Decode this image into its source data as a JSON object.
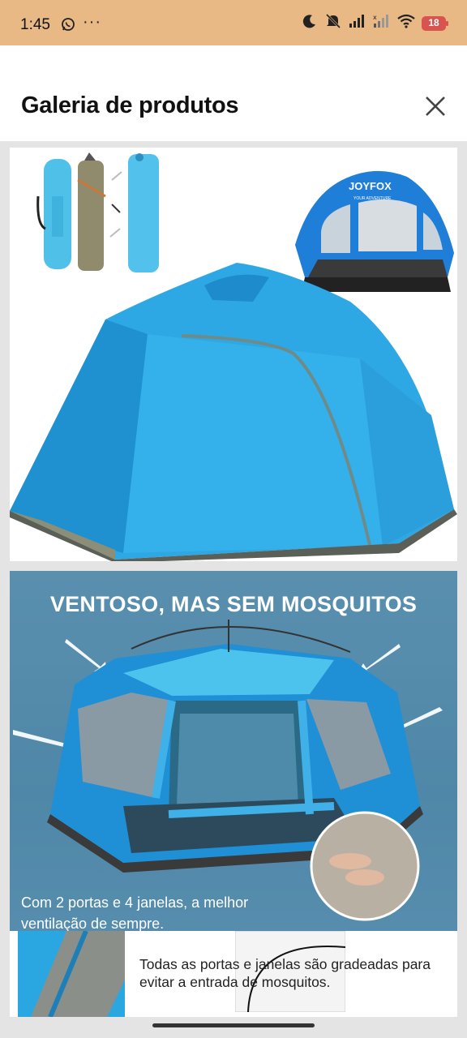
{
  "status_bar": {
    "time": "1:45",
    "battery": "18",
    "icons": [
      "whatsapp-icon",
      "more-icon",
      "moon-icon",
      "mute-icon",
      "signal-icon",
      "signal-2-icon",
      "wifi-icon",
      "battery-icon"
    ]
  },
  "header": {
    "title": "Galeria de produtos",
    "close_icon": "close-icon"
  },
  "gallery": {
    "image1": {
      "brand": "JOYFOX",
      "brand_tagline": "YOUR ADVENTURE"
    },
    "image2": {
      "headline": "VENTOSO, MAS SEM MOSQUITOS",
      "caption_1": "Com 2 portas e 4 janelas, a melhor ventilação de sempre.",
      "caption_2": "Todas as portas e janelas são gradeadas para evitar a entrada de mosquitos."
    }
  },
  "colors": {
    "status_bar_bg": "#e8b985",
    "tent_blue": "#2aa6e0",
    "banner_blue": "#5a8fae",
    "battery_red": "#d9534f"
  }
}
